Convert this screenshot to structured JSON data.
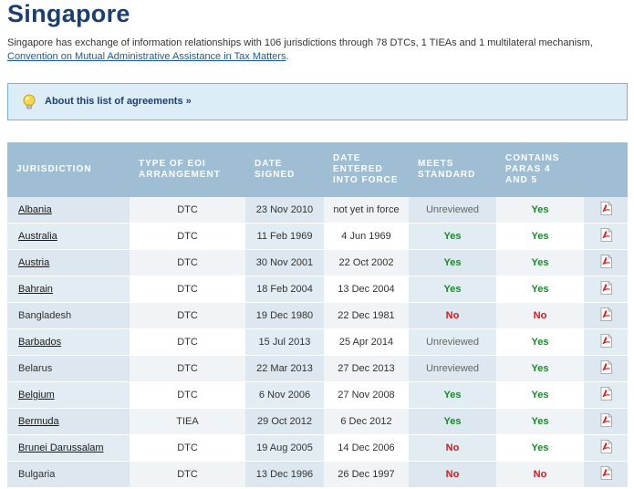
{
  "page_title": "Singapore",
  "intro_text": "Singapore has exchange of information relationships with 106 jurisdictions through 78 DTCs, 1 TIEAs and 1 multilateral mechanism,",
  "intro_link": "Convention on Mutual Administrative Assistance in Tax Matters",
  "intro_end": ".",
  "about_link": "About this list of agreements »",
  "headers": [
    "JURISDICTION",
    "TYPE OF EOI ARRANGEMENT",
    "DATE SIGNED",
    "DATE ENTERED INTO FORCE",
    "MEETS STANDARD",
    "CONTAINS PARAS 4 AND 5"
  ],
  "rows": [
    {
      "jurisdiction": "Albania",
      "linked": true,
      "type": "DTC",
      "signed": "23 Nov 2010",
      "force": "not yet in force",
      "meets": "Unreviewed",
      "paras": "Yes"
    },
    {
      "jurisdiction": "Australia",
      "linked": true,
      "type": "DTC",
      "signed": "11 Feb 1969",
      "force": "4 Jun 1969",
      "meets": "Yes",
      "paras": "Yes"
    },
    {
      "jurisdiction": "Austria",
      "linked": true,
      "type": "DTC",
      "signed": "30 Nov 2001",
      "force": "22 Oct 2002",
      "meets": "Yes",
      "paras": "Yes"
    },
    {
      "jurisdiction": "Bahrain",
      "linked": true,
      "type": "DTC",
      "signed": "18 Feb 2004",
      "force": "13 Dec 2004",
      "meets": "Yes",
      "paras": "Yes"
    },
    {
      "jurisdiction": "Bangladesh",
      "linked": false,
      "type": "DTC",
      "signed": "19 Dec 1980",
      "force": "22 Dec 1981",
      "meets": "No",
      "paras": "No"
    },
    {
      "jurisdiction": "Barbados",
      "linked": true,
      "type": "DTC",
      "signed": "15 Jul 2013",
      "force": "25 Apr 2014",
      "meets": "Unreviewed",
      "paras": "Yes"
    },
    {
      "jurisdiction": "Belarus",
      "linked": false,
      "type": "DTC",
      "signed": "22 Mar 2013",
      "force": "27 Dec 2013",
      "meets": "Unreviewed",
      "paras": "Yes"
    },
    {
      "jurisdiction": "Belgium",
      "linked": true,
      "type": "DTC",
      "signed": "6 Nov 2006",
      "force": "27 Nov 2008",
      "meets": "Yes",
      "paras": "Yes"
    },
    {
      "jurisdiction": "Bermuda",
      "linked": true,
      "type": "TIEA",
      "signed": "29 Oct 2012",
      "force": "6 Dec 2012",
      "meets": "Yes",
      "paras": "Yes"
    },
    {
      "jurisdiction": "Brunei Darussalam",
      "linked": true,
      "type": "DTC",
      "signed": "19 Aug 2005",
      "force": "14 Dec 2006",
      "meets": "No",
      "paras": "Yes"
    },
    {
      "jurisdiction": "Bulgaria",
      "linked": false,
      "type": "DTC",
      "signed": "13 Dec 1996",
      "force": "26 Dec 1997",
      "meets": "No",
      "paras": "No"
    }
  ],
  "colors": {
    "title": "#1c3f6e",
    "header_bg": "#9fbdd3",
    "yes": "#198a2a",
    "no": "#d9161c",
    "about_bg": "#dcedf7"
  },
  "icons": {
    "about": "lightbulb-icon",
    "pdf": "pdf-icon"
  }
}
